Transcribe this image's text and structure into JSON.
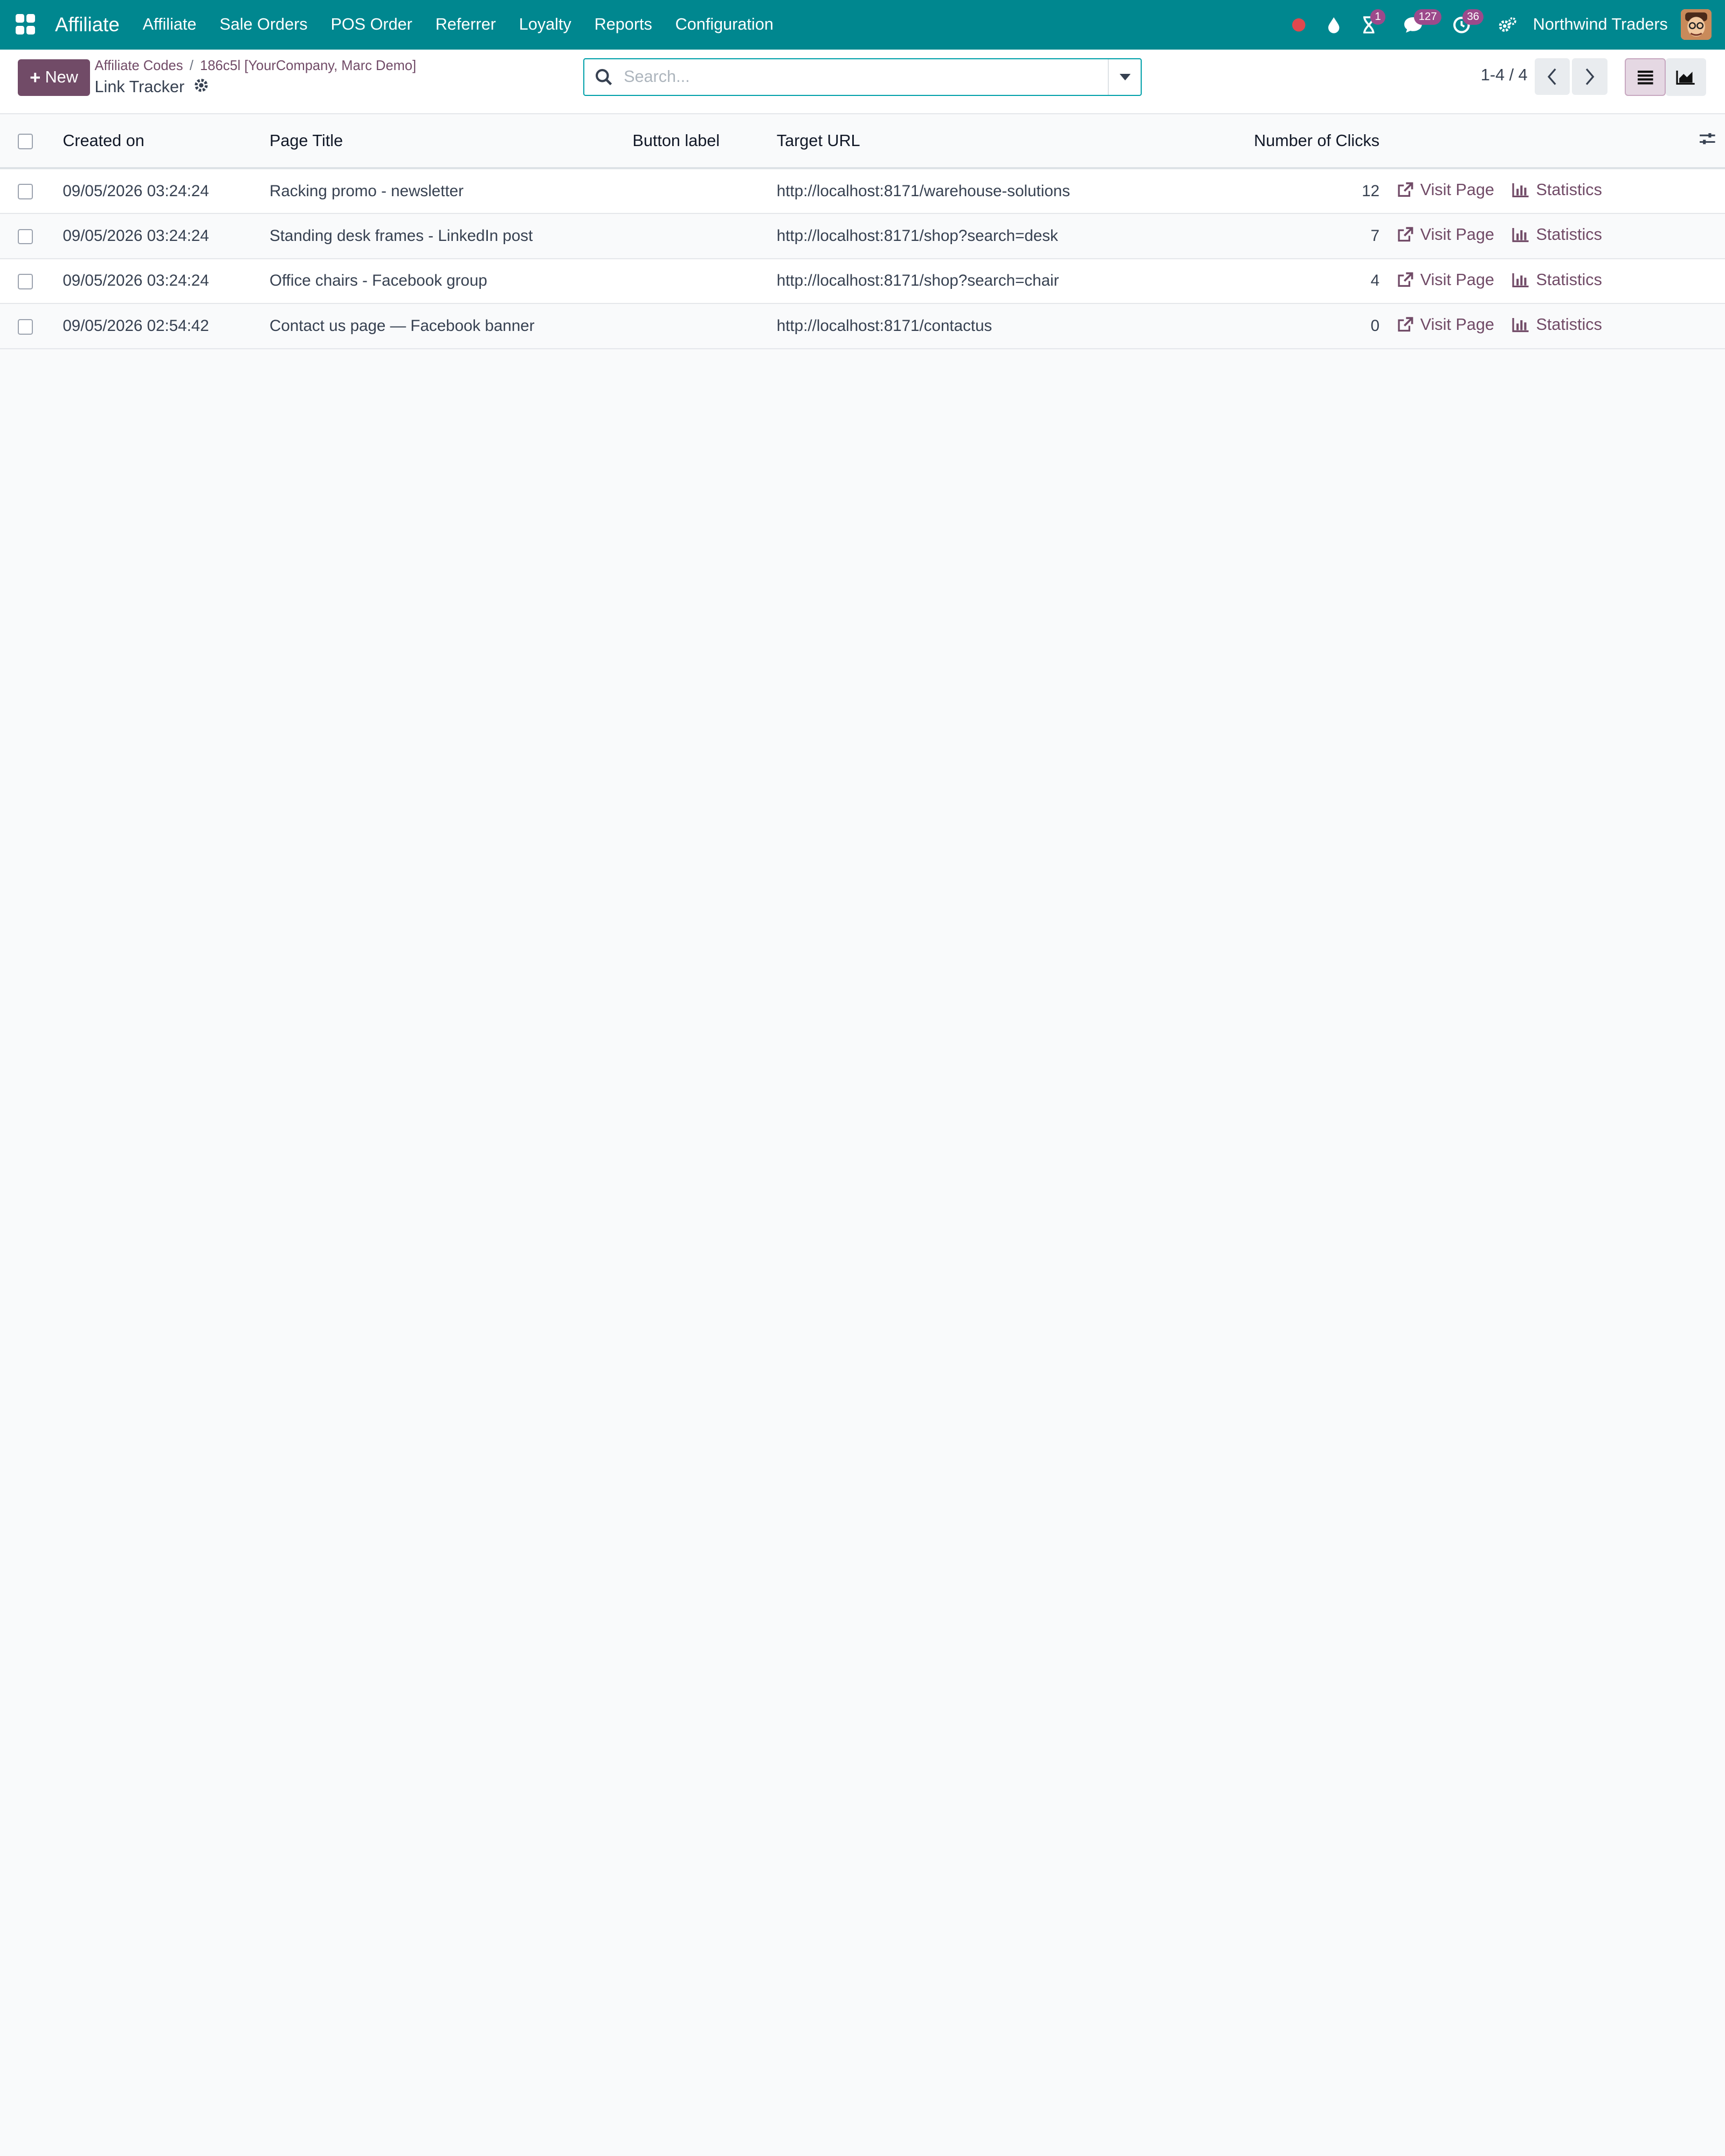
{
  "navbar": {
    "brand": "Affiliate",
    "menu": [
      "Affiliate",
      "Sale Orders",
      "POS Order",
      "Referrer",
      "Loyalty",
      "Reports",
      "Configuration"
    ],
    "badges": {
      "activity": "1",
      "messages": "127",
      "timer": "36"
    },
    "company": "Northwind Traders",
    "colors": {
      "bar": "#00878f",
      "badge": "#9c4a8b",
      "record": "#e0484e"
    }
  },
  "control": {
    "new_label": "New",
    "breadcrumb": [
      "Affiliate Codes",
      "186c5l [YourCompany, Marc Demo]"
    ],
    "page_title": "Link Tracker",
    "search_placeholder": "Search...",
    "pager": "1-4 / 4",
    "accent": "#714b67"
  },
  "table": {
    "columns": [
      "Created on",
      "Page Title",
      "Button label",
      "Target URL",
      "Number of Clicks"
    ],
    "action_labels": {
      "visit": "Visit Page",
      "stats": "Statistics"
    },
    "rows": [
      {
        "created": "09/05/2026 03:24:24",
        "title": "Racking promo - newsletter",
        "button_label": "",
        "url": "http://localhost:8171/warehouse-solutions",
        "clicks": "12"
      },
      {
        "created": "09/05/2026 03:24:24",
        "title": "Standing desk frames - LinkedIn post",
        "button_label": "",
        "url": "http://localhost:8171/shop?search=desk",
        "clicks": "7"
      },
      {
        "created": "09/05/2026 03:24:24",
        "title": "Office chairs - Facebook group",
        "button_label": "",
        "url": "http://localhost:8171/shop?search=chair",
        "clicks": "4"
      },
      {
        "created": "09/05/2026 02:54:42",
        "title": "Contact us page — Facebook banner",
        "button_label": "",
        "url": "http://localhost:8171/contactus",
        "clicks": "0"
      }
    ]
  }
}
